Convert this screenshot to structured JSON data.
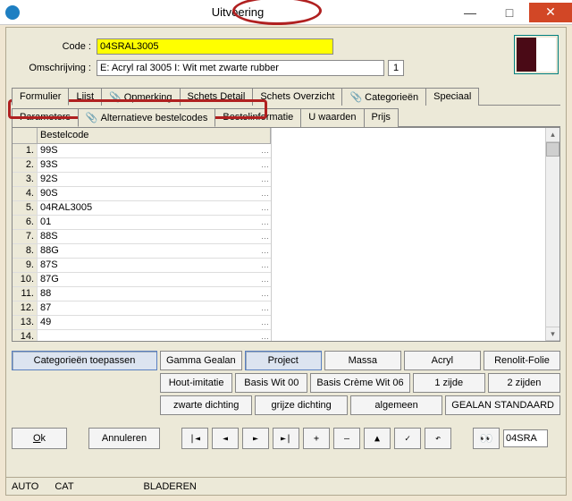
{
  "window": {
    "title": "Uitvoering",
    "min": "—",
    "max": "□",
    "close": "✕"
  },
  "header": {
    "code_label": "Code :",
    "code_value": "04SRAL3005",
    "desc_label": "Omschrijving :",
    "desc_value": "E: Acryl ral 3005 I: Wit met zwarte rubber",
    "copies": "1"
  },
  "tabs": {
    "main": [
      "Formulier",
      "Lijst",
      "Opmerking",
      "Schets Detail",
      "Schets Overzicht",
      "Categorieën",
      "Speciaal"
    ],
    "sub": [
      "Parameters",
      "Alternatieve bestelcodes",
      "Bestelinformatie",
      "U waarden",
      "Prijs"
    ],
    "clip_tabs": [
      2,
      5
    ]
  },
  "grid": {
    "header": "Bestelcode",
    "rows": [
      "99S",
      "93S",
      "92S",
      "90S",
      "04RAL3005",
      "01",
      "88S",
      "88G",
      "87S",
      "87G",
      "88",
      "87",
      "49",
      ""
    ]
  },
  "filters": {
    "row1": [
      "Categorieën toepassen",
      "Gamma Gealan",
      "Project",
      "Massa",
      "Acryl",
      "Renolit-Folie"
    ],
    "row2": [
      "Hout-imitatie",
      "Basis Wit 00",
      "Basis Crème Wit 06",
      "1 zijde",
      "2 zijden"
    ],
    "row3": [
      "zwarte dichting",
      "grijze dichting",
      "algemeen",
      "GEALAN STANDAARD"
    ]
  },
  "nav": {
    "ok": "Ok",
    "cancel": "Annuleren",
    "first": "|◄",
    "prev": "◄",
    "next": "►",
    "last": "►|",
    "plus": "+",
    "minus": "—",
    "up": "▲",
    "check": "✓",
    "undo": "↶",
    "find": "👀",
    "search_val": "04SRA"
  },
  "status": {
    "a": "AUTO",
    "b": "CAT",
    "c": "BLADEREN"
  }
}
